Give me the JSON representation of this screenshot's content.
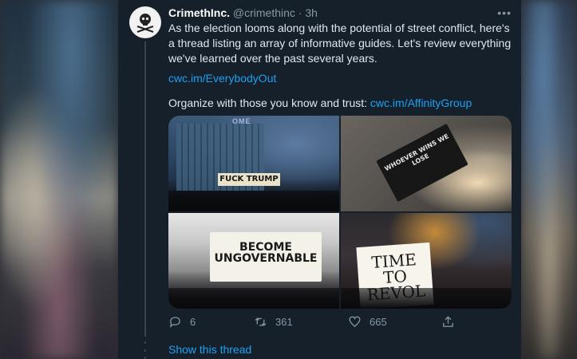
{
  "tweet": {
    "author_name": "CrimethInc.",
    "handle": "@crimethinc",
    "separator": "·",
    "time": "3h",
    "more_icon": "more-horizontal-icon",
    "text": "As the election looms along with the potential of street conflict, here's a thread listing an array of informative guides. Let's review everything we've learned over the past several years.",
    "link1": "cwc.im/EverybodyOut",
    "line3_prefix": "Organize with those you know and trust: ",
    "link2": "cwc.im/AffinityGroup"
  },
  "images": {
    "img1_sign": "FUCK TRUMP",
    "img1_dome": "OME",
    "img2_mat": "WHOEVER WINS WE LOSE",
    "img3_sign": "BECOME UNGOVERNABLE",
    "img4_sign": "TIME TO REVOL"
  },
  "actions": {
    "replies": "6",
    "retweets": "361",
    "likes": "665",
    "reply_icon": "reply-icon",
    "retweet_icon": "retweet-icon",
    "like_icon": "heart-icon",
    "share_icon": "share-icon"
  },
  "show_thread": "Show this thread",
  "colors": {
    "panel_bg": "#15202b",
    "link": "#1da1f2",
    "muted": "#8899a6",
    "text": "#e1e8ed"
  }
}
